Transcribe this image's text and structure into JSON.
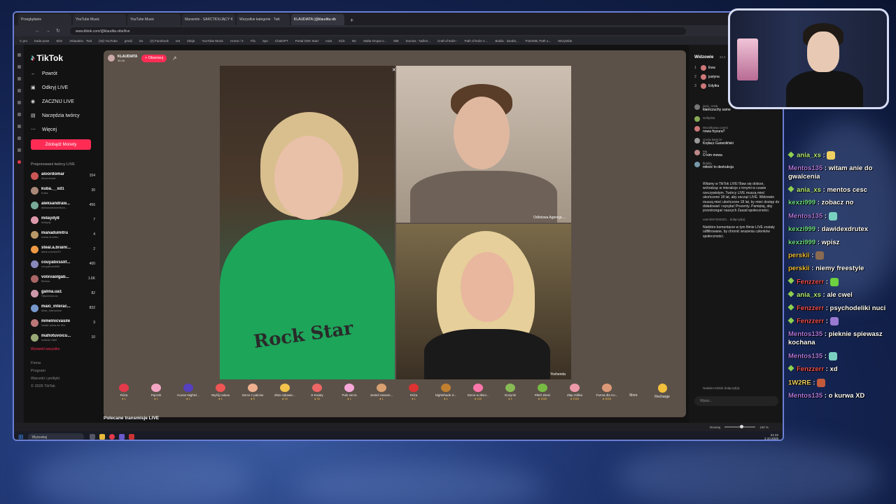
{
  "browser": {
    "tabs": [
      {
        "label": "Przeglądanie",
        "active": false
      },
      {
        "label": "YouTube Music",
        "active": false
      },
      {
        "label": "YouTube Music",
        "active": false
      },
      {
        "label": "Mansmiin - SARCTIDUJĄCY K",
        "active": false
      },
      {
        "label": "Wszystkie kategorie · Twit",
        "active": false
      },
      {
        "label": "KLAUDIATA (@klaudita.vib",
        "active": true
      }
    ],
    "url": "www.tiktok.com/@klaudita.vibe/live",
    "bookmarks": [
      "C pro",
      "trade pose",
      "Stim",
      "zKlaudeio · Twit",
      "(33) YouTube",
      "gmail",
      "ins",
      "(2) Facebook",
      "net",
      "Zdeje",
      "YouTube Music",
      "Home / X",
      "Flix",
      "Spo",
      "ChatGPT",
      "Portal OSK Start",
      "Auta",
      "Kick",
      "NC",
      "Malta Grupa U...",
      "Mitt",
      "Survios · Nullen...",
      "Craft of Exile -",
      "Path of Exile 2 ...",
      "Buildx · itxedst...",
      "PoE2DB, Path o...",
      "Wszystkie"
    ]
  },
  "sidebar": {
    "logo": "TikTok",
    "back": "Powrót",
    "links": [
      {
        "label": "Odkryj LIVE",
        "icon": "live-icon"
      },
      {
        "label": "ZACZNIJ LIVE",
        "icon": "camera-icon"
      },
      {
        "label": "Narzędzia twórcy",
        "icon": "tools-icon"
      },
      {
        "label": "Więcej",
        "icon": "more-icon"
      }
    ],
    "coins_button": "Zdobądź Monety",
    "proposed_header": "Proponowani twórcy LIVE",
    "creators": [
      {
        "name": "aloordomar",
        "sub": "Aloordomar",
        "count": "154",
        "color": "#c55"
      },
      {
        "name": "kuba.__xd1",
        "sub": "Kuba",
        "count": "30",
        "color": "#a87"
      },
      {
        "name": "aleksandraw...",
        "sub": "aleksandrawedkow...",
        "count": "456",
        "color": "#7a9"
      },
      {
        "name": "milaydy8",
        "sub": "milaydy",
        "count": "7",
        "color": "#d9a"
      },
      {
        "name": "manadumitru",
        "sub": "maria dumitru",
        "count": "4",
        "color": "#b96"
      },
      {
        "name": "steal.a.brainr...",
        "sub": "steal.a.brainr29",
        "count": "2",
        "color": "#e94"
      },
      {
        "name": "couyabxsslif...",
        "sub": "couyabxsslif45",
        "count": "400",
        "color": "#88b"
      },
      {
        "name": "volxvaolgab...",
        "sub": "Bemss",
        "count": "1.6K",
        "color": "#a66"
      },
      {
        "name": "galina.ua1",
        "sub": "Прыгалка ua",
        "count": "82",
        "color": "#c9a"
      },
      {
        "name": "maxi_interac...",
        "sub": "Maxi_Interactive",
        "count": "832",
        "color": "#79c"
      },
      {
        "name": "mmelnicvasile",
        "sub": "Vasile Iulica de ISU",
        "count": "3",
        "color": "#b77"
      },
      {
        "name": "mafiotuvoicu...",
        "sub": "mafiotu Stefi",
        "count": "10",
        "color": "#9a7"
      }
    ],
    "show_all": "Wyświetl wszystko",
    "footer": [
      "Firma",
      "Program",
      "Warunki i polityki",
      "© 2025 TikTok"
    ]
  },
  "stage": {
    "host_name": "KLAUDIATA",
    "host_likes": "35,3K",
    "follow_label": "+ Obserwuj",
    "panel_tr_label": "Odlotowa Agencja ...",
    "panel_br_label": "Yovhenda",
    "shirt_text": "Rock Star",
    "gifts": [
      {
        "name": "Róża",
        "price": "1",
        "color": "#e23a4a"
      },
      {
        "name": "Pączek",
        "price": "1",
        "color": "#f3a6c4"
      },
      {
        "name": "House Nightcl...",
        "price": "1",
        "color": "#5540c0"
      },
      {
        "name": "Wyślij całusa",
        "price": "1",
        "color": "#e55"
      },
      {
        "name": "Serce z palców",
        "price": "5",
        "color": "#f0b090"
      },
      {
        "name": "Złoto rękawic...",
        "price": "10",
        "color": "#f2c24a"
      },
      {
        "name": "S Kwiaty",
        "price": "30",
        "color": "#e66"
      },
      {
        "name": "Puls serca",
        "price": "1",
        "color": "#f7a8d8"
      },
      {
        "name": "Jesteś niesam...",
        "price": "1",
        "color": "#d9a070"
      },
      {
        "name": "Róża",
        "price": "1",
        "color": "#d33"
      },
      {
        "name": "Nightshade S...",
        "price": "1",
        "color": "#c08030"
      },
      {
        "name": "Serce w dłoni...",
        "price": "100",
        "color": "#f7a"
      },
      {
        "name": "Dożynki",
        "price": "1",
        "color": "#8b5"
      },
      {
        "name": "Płetń Ziemi",
        "price": "1000",
        "color": "#7b4"
      },
      {
        "name": "Złap Ziółka",
        "price": "1000",
        "color": "#e9a"
      },
      {
        "name": "Farma dla Ce...",
        "price": "5000",
        "color": "#d97"
      }
    ],
    "more_label": "More",
    "recharge_label": "Recharge",
    "recommended_label": "Polecane transmisje LIVE"
  },
  "chat": {
    "viewers_title": "Widzowie",
    "viewers_count": "33,4",
    "top_viewers": [
      {
        "rank": "1",
        "name": "Ewa"
      },
      {
        "rank": "2",
        "name": "justyna"
      },
      {
        "rank": "3",
        "name": "Edytka"
      }
    ],
    "messages": [
      {
        "user": "jasiy_rosia",
        "text": "kłamczuchy same",
        "color": "#777"
      },
      {
        "user": "Softyska",
        "text": "",
        "color": "#8a5"
      },
      {
        "user": "Wszelkowa czemi",
        "text": "nowa fryzura?",
        "color": "#c77"
      },
      {
        "user": "ciocia kamrze",
        "text": "Kręłacz Garwoliński",
        "color": "#999"
      },
      {
        "user": "Ma",
        "text": "O kim mowa",
        "color": "#b88"
      },
      {
        "user": "fildella",
        "text": "miłość to destrukcja",
        "color": "#79a"
      }
    ],
    "welcome": "Witamy w TikTok LIVE! Baw się dobrze, wchodząc w interakcje z innymi w czasie rzeczywistym. Twórcy LIVE muszą mieć ukończone 18 lat, aby zacząć LIVE. Widzowie muszą mieć ukończone 18 lat, by mieć dostęp do doładowań i wysyłać Prezenty. Pamiętaj, aby przestrzegać naszych Zasad społeczności.",
    "joined": "user4847294324...   dołączył(a)",
    "filtered": "Niektóre komentarze w tym filmie LIVE zostały odfiltrowane, by chronić wrażenia członków społeczności.",
    "joined_bottom": "Natalia Hol2d4   dołączył(a)",
    "input_placeholder": "Wpisz..."
  },
  "status": {
    "zoom_label": "Resetuj",
    "zoom_value": "100 %",
    "zoom_level": 0.5,
    "search_placeholder": "Wyszukaj",
    "time": "21:42",
    "date": "2.10.2025"
  },
  "stream_chat": [
    {
      "user": "ania_xs",
      "color": "#b9f07a",
      "badge": true,
      "text": "",
      "emote": "#f0d060"
    },
    {
      "user": "Mentos135",
      "color": "#b07ae0",
      "badge": false,
      "text": "witam anie do gwalcenia",
      "emote": ""
    },
    {
      "user": "ania_xs",
      "color": "#b9f07a",
      "badge": true,
      "text": "mentos cesc",
      "emote": ""
    },
    {
      "user": "kexzi999",
      "color": "#6fe08a",
      "badge": false,
      "text": "zobacz no",
      "emote": ""
    },
    {
      "user": "Mentos135",
      "color": "#b07ae0",
      "badge": false,
      "text": "",
      "emote": "#7ad0c0"
    },
    {
      "user": "kexzi999",
      "color": "#6fe08a",
      "badge": false,
      "text": "dawidexdrutex",
      "emote": ""
    },
    {
      "user": "kexzi999",
      "color": "#6fe08a",
      "badge": false,
      "text": "wpisz",
      "emote": ""
    },
    {
      "user": "perskii",
      "color": "#f0c040",
      "badge": false,
      "text": "",
      "emote": "#8a6a50"
    },
    {
      "user": "perskii",
      "color": "#f0c040",
      "badge": false,
      "text": "niemy freestyle",
      "emote": ""
    },
    {
      "user": "Fenzzerr",
      "color": "#f05050",
      "badge": true,
      "text": "",
      "emote": "#6dd040"
    },
    {
      "user": "ania_xs",
      "color": "#b9f07a",
      "badge": true,
      "text": "ale cwel",
      "emote": ""
    },
    {
      "user": "Fenzzerr",
      "color": "#f05050",
      "badge": true,
      "text": "psychodeliki nuci",
      "emote": ""
    },
    {
      "user": "Fenzzerr",
      "color": "#f05050",
      "badge": true,
      "text": "",
      "emote": "#9a7ad0"
    },
    {
      "user": "Mentos135",
      "color": "#b07ae0",
      "badge": false,
      "text": "pieknie spiewasz kochana",
      "emote": ""
    },
    {
      "user": "Mentos135",
      "color": "#b07ae0",
      "badge": false,
      "text": "",
      "emote": "#7ad0c0"
    },
    {
      "user": "Fenzzerr",
      "color": "#f05050",
      "badge": true,
      "text": "xd",
      "emote": ""
    },
    {
      "user": "1W2RE",
      "color": "#f0d060",
      "badge": false,
      "text": "",
      "emote": "#c05a3a"
    },
    {
      "user": "Mentos135",
      "color": "#b07ae0",
      "badge": false,
      "text": "o kurwa XD",
      "emote": ""
    }
  ]
}
